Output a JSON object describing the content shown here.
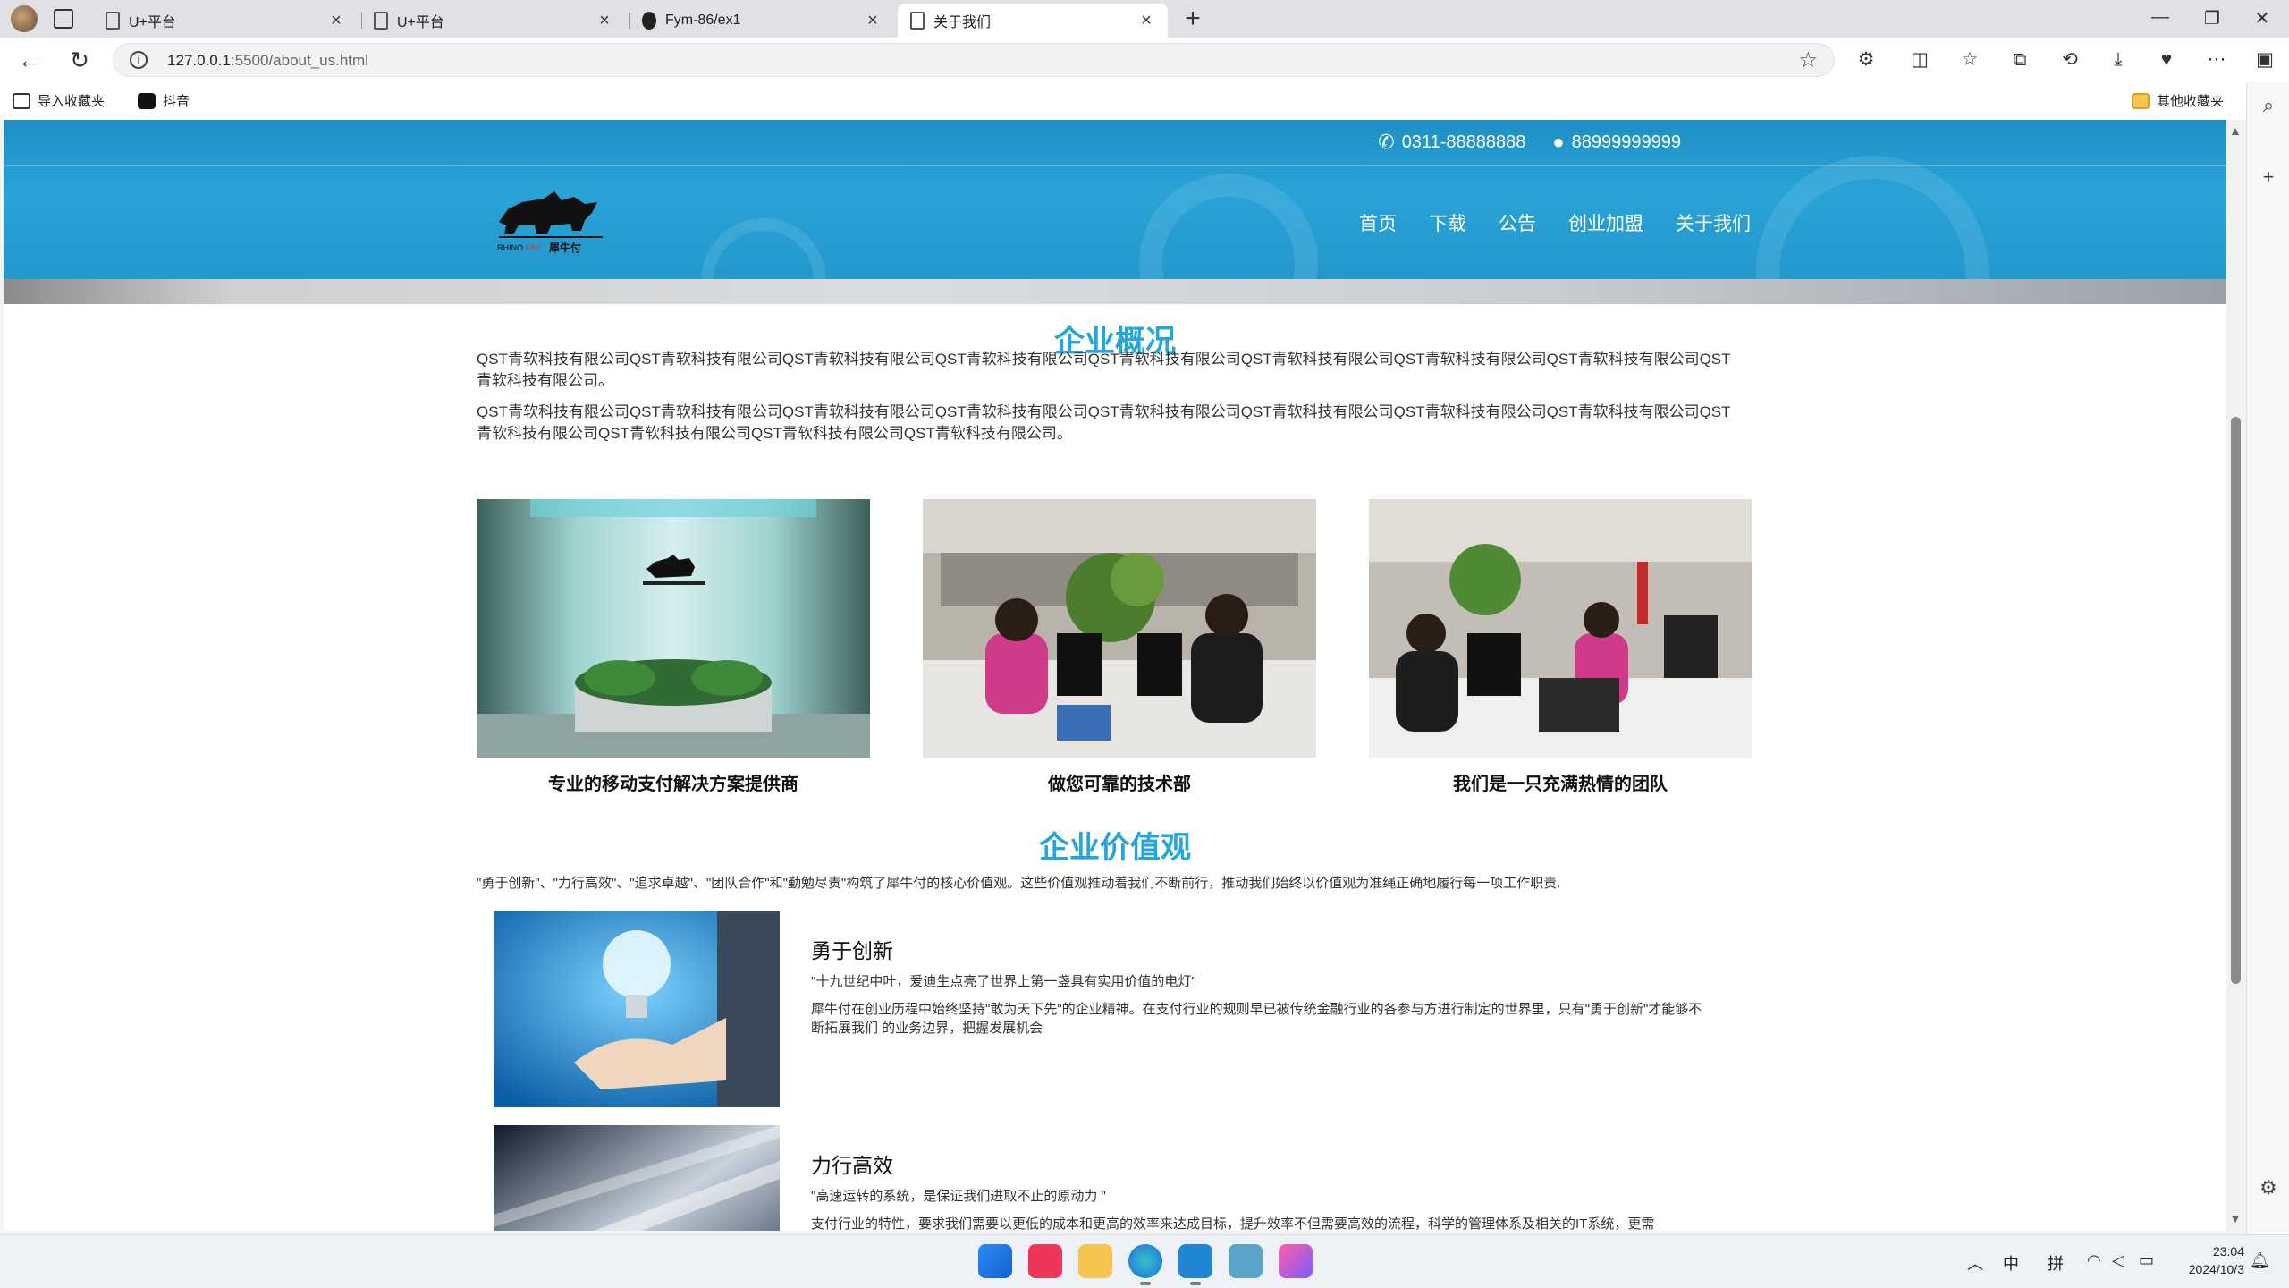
{
  "browser": {
    "tabs": [
      {
        "label": "U+平台",
        "icon": "page-icon"
      },
      {
        "label": "U+平台",
        "icon": "page-icon"
      },
      {
        "label": "Fym-86/ex1",
        "icon": "github-icon"
      },
      {
        "label": "关于我们",
        "icon": "page-icon"
      }
    ],
    "new_tab": "+",
    "url_host": "127.0.0.1",
    "url_path": ":5500/about_us.html",
    "bookmarks": {
      "import": "导入收藏夹",
      "douyin": "抖音",
      "other": "其他收藏夹"
    }
  },
  "site": {
    "phone": "0311-88888888",
    "qq": "88999999999",
    "logo_text": "RHINO PAY 犀牛付",
    "nav": [
      "首页",
      "下载",
      "公告",
      "创业加盟",
      "关于我们"
    ]
  },
  "overview": {
    "title": "企业概况",
    "p1": "QST青软科技有限公司QST青软科技有限公司QST青软科技有限公司QST青软科技有限公司QST青软科技有限公司QST青软科技有限公司QST青软科技有限公司QST青软科技有限公司QST青软科技有限公司。",
    "p2": "QST青软科技有限公司QST青软科技有限公司QST青软科技有限公司QST青软科技有限公司QST青软科技有限公司QST青软科技有限公司QST青软科技有限公司QST青软科技有限公司QST青软科技有限公司QST青软科技有限公司QST青软科技有限公司QST青软科技有限公司。",
    "photos": [
      {
        "caption": "专业的移动支付解决方案提供商"
      },
      {
        "caption": "做您可靠的技术部"
      },
      {
        "caption": "我们是一只充满热情的团队"
      }
    ]
  },
  "values": {
    "title": "企业价值观",
    "intro": "\"勇于创新\"、\"力行高效\"、\"追求卓越\"、\"团队合作\"和\"勤勉尽责\"构筑了犀牛付的核心价值观。这些价值观推动着我们不断前行，推动我们始终以价值观为准绳正确地履行每一项工作职责.",
    "items": [
      {
        "title": "勇于创新",
        "quote": "\"十九世纪中叶，爱迪生点亮了世界上第一盏具有实用价值的电灯\"",
        "desc": "犀牛付在创业历程中始终坚持\"敢为天下先\"的企业精神。在支付行业的规则早已被传统金融行业的各参与方进行制定的世界里，只有\"勇于创新\"才能够不断拓展我们 的业务边界，把握发展机会"
      },
      {
        "title": "力行高效",
        "quote": "\"高速运转的系统，是保证我们进取不止的原动力 \"",
        "desc": "支付行业的特性，要求我们需要以更低的成本和更高的效率来达成目标，提升效率不但需要高效的流程，科学的管理体系及相关的IT系统，更需"
      }
    ]
  },
  "taskbar": {
    "ime_lang": "中",
    "ime_mode": "拼",
    "time": "23:04",
    "date": "2024/10/3"
  },
  "colors": {
    "accent": "#22a6dc",
    "header": "#2398cc"
  }
}
